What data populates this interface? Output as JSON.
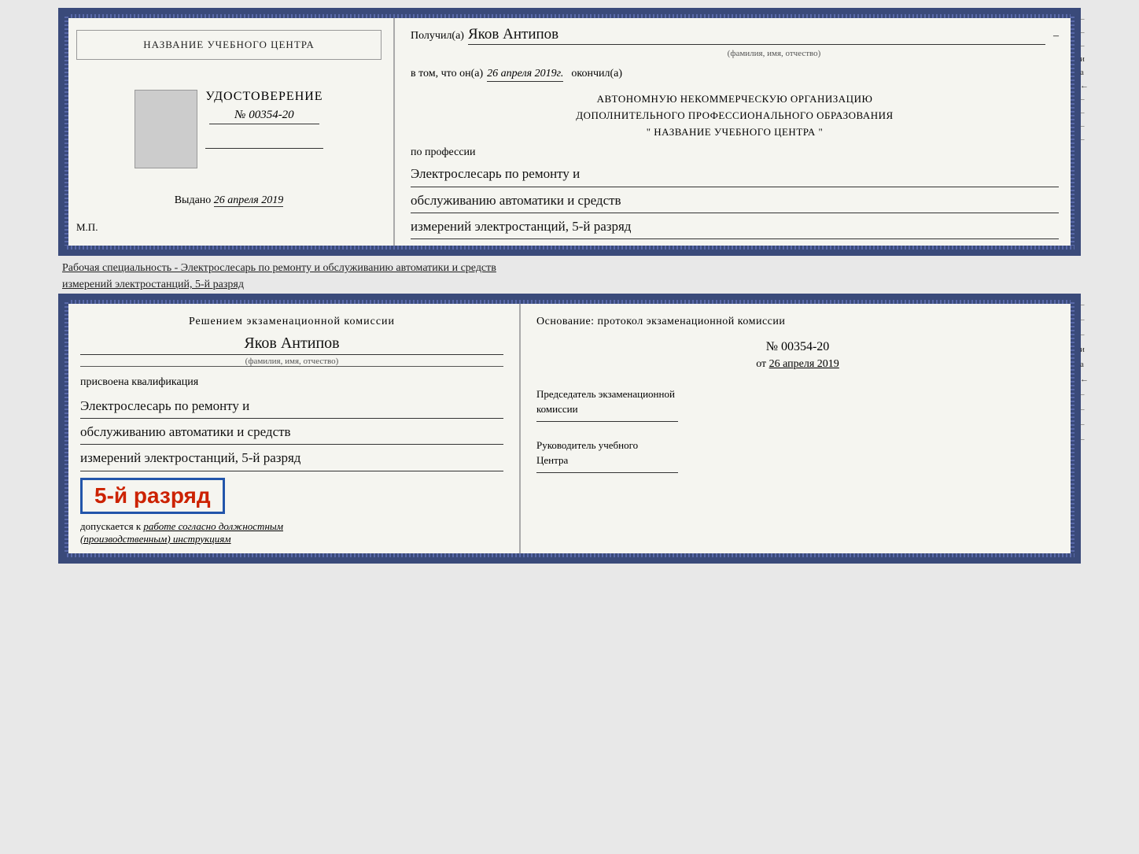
{
  "top": {
    "left": {
      "center_name": "НАЗВАНИЕ УЧЕБНОГО ЦЕНТРА",
      "udostoverenie_title": "УДОСТОВЕРЕНИЕ",
      "number": "№ 00354-20",
      "vydano_label": "Выдано",
      "vydano_date": "26 апреля 2019",
      "mp": "М.П."
    },
    "right": {
      "poluchil_label": "Получил(а)",
      "name_handwritten": "Яков Антипов",
      "fio_label": "(фамилия, имя, отчество)",
      "vtom_label": "в том, что он(а)",
      "vtom_date": "26 апреля 2019г.",
      "okonchil_label": "окончил(а)",
      "org_line1": "АВТОНОМНУЮ НЕКОММЕРЧЕСКУЮ ОРГАНИЗАЦИЮ",
      "org_line2": "ДОПОЛНИТЕЛЬНОГО ПРОФЕССИОНАЛЬНОГО ОБРАЗОВАНИЯ",
      "org_line3": "\"  НАЗВАНИЕ УЧЕБНОГО ЦЕНТРА  \"",
      "po_professii": "по профессии",
      "profession_line1": "Электрослесарь по ремонту и",
      "profession_line2": "обслуживанию автоматики и средств",
      "profession_line3": "измерений электростанций, 5-й разряд",
      "side_marks": [
        "–",
        "–",
        "–",
        "и",
        "а",
        "←",
        "–",
        "–",
        "–",
        "–"
      ]
    }
  },
  "between": {
    "text_line1": "Рабочая специальность - Электрослесарь по ремонту и обслуживанию автоматики и средств",
    "text_line2": "измерений электростанций, 5-й разряд"
  },
  "bottom": {
    "left": {
      "resheniem_title": "Решением экзаменационной комиссии",
      "name_handwritten": "Яков Антипов",
      "fio_label": "(фамилия, имя, отчество)",
      "prisvoena": "присвоена квалификация",
      "profession_line1": "Электрослесарь по ремонту и",
      "profession_line2": "обслуживанию автоматики и средств",
      "profession_line3": "измерений электростанций, 5-й разряд",
      "razryad_badge": "5-й разряд",
      "dopuskaetsya_label": "допускается к",
      "dopuskaetsya_text": "работе согласно должностным",
      "dopuskaetsya_text2": "(производственным) инструкциям"
    },
    "right": {
      "osnovanie_label": "Основание: протокол экзаменационной комиссии",
      "protocol_number": "№  00354-20",
      "ot_label": "от",
      "ot_date": "26 апреля 2019",
      "chairman_label": "Председатель экзаменационной",
      "chairman_label2": "комиссии",
      "rukovoditel_label": "Руководитель учебного",
      "rukovoditel_label2": "Центра",
      "side_marks": [
        "–",
        "–",
        "–",
        "и",
        "а",
        "←",
        "–",
        "–",
        "–",
        "–"
      ]
    }
  }
}
